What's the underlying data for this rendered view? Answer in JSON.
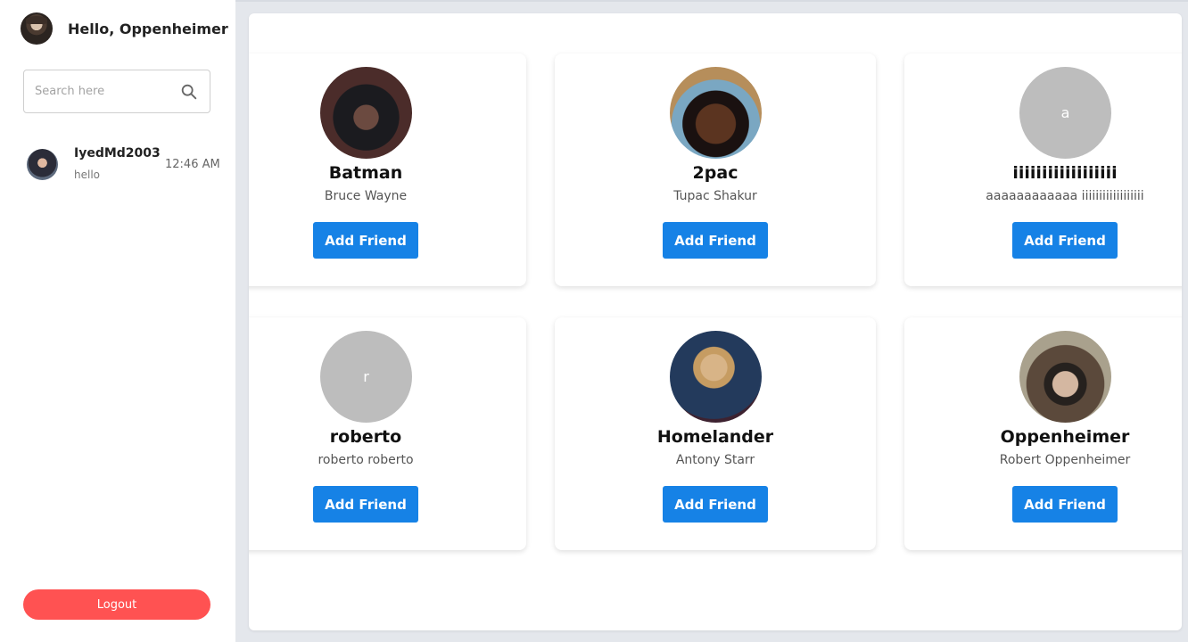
{
  "header": {
    "greeting": "Hello, Oppenheimer"
  },
  "search": {
    "placeholder": "Search here"
  },
  "chats": [
    {
      "name": "IyedMd2003",
      "message": "hello",
      "time": "12:46 AM"
    }
  ],
  "logout_label": "Logout",
  "users": [
    {
      "username": "Batman",
      "full_name": "Bruce Wayne",
      "initial": "",
      "button": "Add Friend"
    },
    {
      "username": "2pac",
      "full_name": "Tupac Shakur",
      "initial": "",
      "button": "Add Friend"
    },
    {
      "username": "iiiiiiiiiiiiiiiiii",
      "full_name": "aaaaaaaaaaaa iiiiiiiiiiiiiiiiii",
      "initial": "a",
      "button": "Add Friend"
    },
    {
      "username": "roberto",
      "full_name": "roberto roberto",
      "initial": "r",
      "button": "Add Friend"
    },
    {
      "username": "Homelander",
      "full_name": "Antony Starr",
      "initial": "",
      "button": "Add Friend"
    },
    {
      "username": "Oppenheimer",
      "full_name": "Robert Oppenheimer",
      "initial": "",
      "button": "Add Friend"
    }
  ],
  "colors": {
    "primary": "#1682e6",
    "logout": "#ff5252",
    "placeholder_avatar": "#bdbdbd"
  }
}
